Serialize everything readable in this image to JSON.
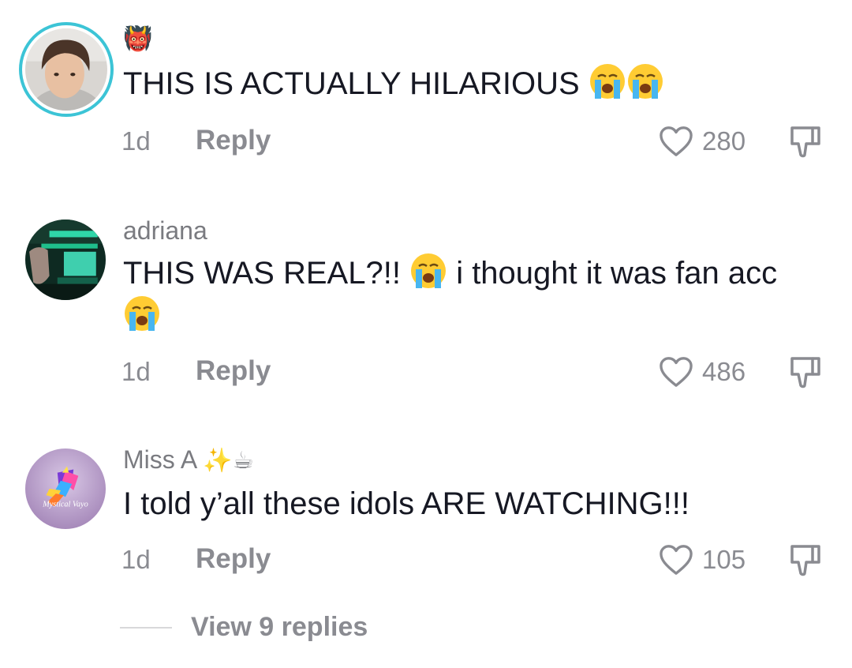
{
  "comments": [
    {
      "username": "",
      "username_emoji": "👹",
      "text": "THIS IS ACTUALLY HILARIOUS",
      "text_emoji": "😭😭",
      "time": "1d",
      "reply_label": "Reply",
      "likes": "280"
    },
    {
      "username": "adriana",
      "text": "THIS WAS REAL?!!",
      "text_emoji": "😭",
      "text_after": "i thought it was fan acc",
      "text_line2_emoji": "😭",
      "time": "1d",
      "reply_label": "Reply",
      "likes": "486"
    },
    {
      "username": "Miss A",
      "username_emoji": "✨☕",
      "text": "I told y’all these idols ARE WATCHING!!!",
      "time": "1d",
      "reply_label": "Reply",
      "likes": "105"
    }
  ],
  "view_replies": "View 9 replies",
  "avatar3_caption": "Mystical Vayo",
  "colors": {
    "story_ring": "#3cc4d6",
    "muted_text": "#8a8b91",
    "body_text": "#161823"
  },
  "icons": [
    "heart-icon",
    "dislike-icon"
  ]
}
